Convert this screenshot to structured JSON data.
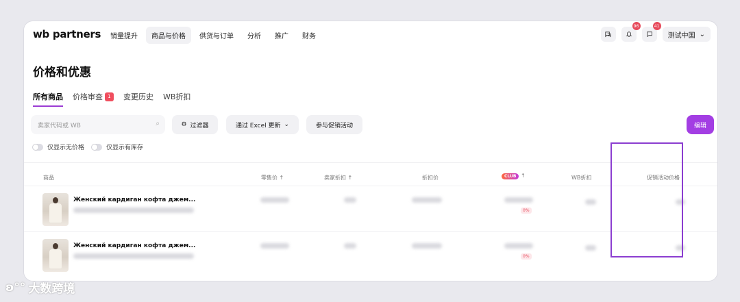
{
  "brand": {
    "logo": "wb partners"
  },
  "nav": [
    "销量提升",
    "商品与价格",
    "供货与订单",
    "分析",
    "推广",
    "财务"
  ],
  "header": {
    "notifications_count": "96",
    "messages_count": "41",
    "account_name": "测试中国"
  },
  "page_title": "价格和优惠",
  "tabs": [
    {
      "label": "所有商品"
    },
    {
      "label": "价格审查",
      "count": "1"
    },
    {
      "label": "变更历史"
    },
    {
      "label": "WB折扣"
    }
  ],
  "toolbar": {
    "search_placeholder": "卖家代码或 WB",
    "filters_label": "过滤器",
    "excel_label": "通过 Excel 更新",
    "promo_label": "参与促销活动",
    "edit_label": "编辑"
  },
  "toggles": [
    "仅显示无价格",
    "仅显示有库存"
  ],
  "table": {
    "columns": [
      "商品",
      "零售价 ↑",
      "卖家折扣 ↑",
      "折扣价",
      "CLUB",
      "↑",
      "WB折扣",
      "促销活动价格"
    ],
    "rows": [
      {
        "name": "Женский кардиган кофта джем...",
        "club_pct": "0%"
      },
      {
        "name": "Женский кардиган кофта джем...",
        "club_pct": "0%"
      }
    ]
  },
  "watermark": "大数跨境",
  "colors": {
    "accent": "#a33ee3",
    "highlight": "#8b3dd0",
    "badge": "#e74b5c"
  }
}
